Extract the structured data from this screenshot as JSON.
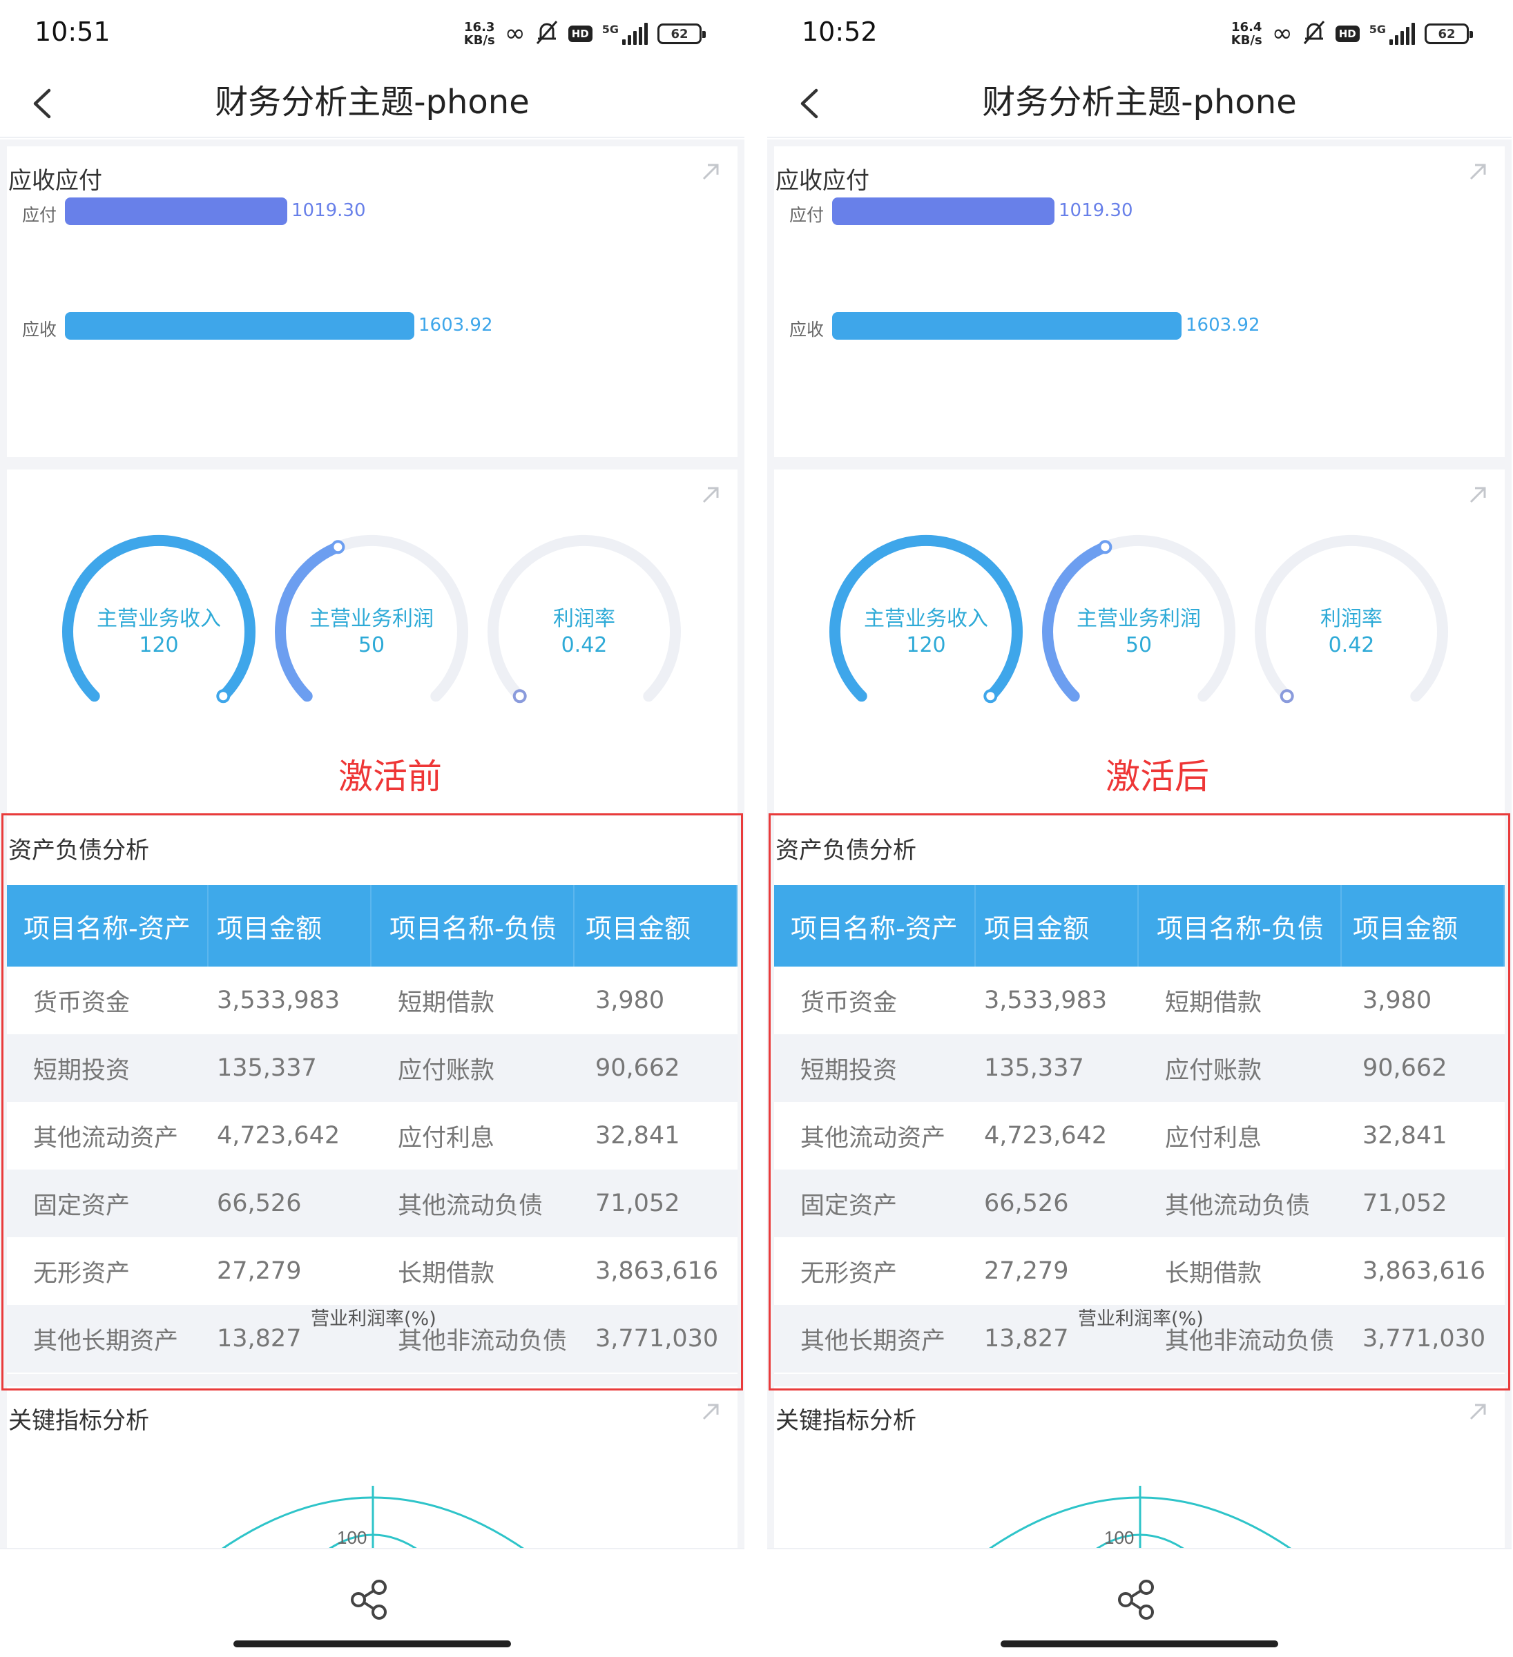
{
  "phones": [
    {
      "status": {
        "time": "10:51",
        "speed_value": "16.3",
        "speed_unit": "KB/s",
        "network": "5G",
        "battery": "62"
      },
      "title": "财务分析主题-phone",
      "state_label": "激活前"
    },
    {
      "status": {
        "time": "10:52",
        "speed_value": "16.4",
        "speed_unit": "KB/s",
        "network": "5G",
        "battery": "62"
      },
      "title": "财务分析主题-phone",
      "state_label": "激活后"
    }
  ],
  "receivables": {
    "title": "应收应付",
    "bars": [
      {
        "label": "应付",
        "value": 1019.3,
        "display": "1019.30",
        "color": "#6880e9"
      },
      {
        "label": "应收",
        "value": 1603.92,
        "display": "1603.92",
        "color": "#3ea6ea"
      }
    ]
  },
  "gauges": [
    {
      "label": "主营业务收入",
      "value": "120",
      "fraction": 1.0,
      "color": "#3ea6ea"
    },
    {
      "label": "主营业务利润",
      "value": "50",
      "fraction": 0.42,
      "color": "#6c9ef0"
    },
    {
      "label": "利润率",
      "value": "0.42",
      "fraction": 0.0,
      "color": "#8a9bdc"
    }
  ],
  "balance_sheet": {
    "title": "资产负债分析",
    "headers": [
      "项目名称-资产",
      "项目金额",
      "项目名称-负债",
      "项目金额"
    ],
    "rows": [
      [
        "货币资金",
        "3,533,983",
        "短期借款",
        "3,980"
      ],
      [
        "短期投资",
        "135,337",
        "应付账款",
        "90,662"
      ],
      [
        "其他流动资产",
        "4,723,642",
        "应付利息",
        "32,841"
      ],
      [
        "固定资产",
        "66,526",
        "其他流动负债",
        "71,052"
      ],
      [
        "无形资产",
        "27,279",
        "长期借款",
        "3,863,616"
      ],
      [
        "其他长期资产",
        "13,827",
        "其他非流动负债",
        "3,771,030"
      ]
    ]
  },
  "kpi": {
    "title": "关键指标分析",
    "radar_axis_label": "营业利润率(%)",
    "radar_tick": "100"
  },
  "colors": {
    "accent": "#3ea9ea",
    "highlight": "#e93b3b",
    "teal": "#2ec4c9"
  }
}
